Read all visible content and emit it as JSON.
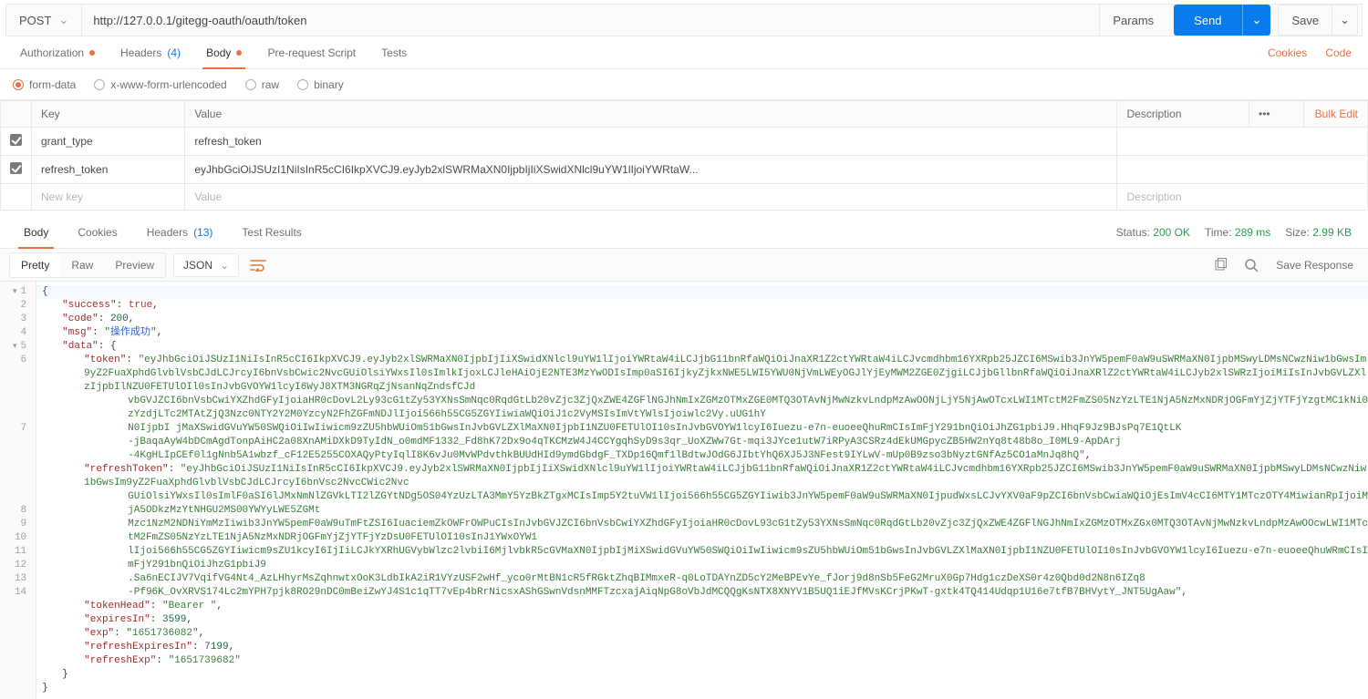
{
  "request": {
    "method": "POST",
    "url": "http://127.0.0.1/gitegg-oauth/oauth/token",
    "buttons": {
      "params": "Params",
      "send": "Send",
      "save": "Save"
    }
  },
  "reqTabs": {
    "auth": "Authorization",
    "headers": "Headers",
    "headers_count": "(4)",
    "body": "Body",
    "prerequest": "Pre-request Script",
    "tests": "Tests",
    "cookies_link": "Cookies",
    "code_link": "Code"
  },
  "bodyTypes": {
    "formdata": "form-data",
    "xwww": "x-www-form-urlencoded",
    "raw": "raw",
    "binary": "binary"
  },
  "formTable": {
    "headers": {
      "key": "Key",
      "value": "Value",
      "desc": "Description",
      "bulk": "Bulk Edit"
    },
    "rows": [
      {
        "key": "grant_type",
        "value": "refresh_token",
        "desc": ""
      },
      {
        "key": "refresh_token",
        "value": "eyJhbGciOiJSUzI1NiIsInR5cCI6IkpXVCJ9.eyJyb2xlSWRMaXN0IjpbIjIiXSwidXNlcl9uYW1lIjoiYWRtaW...",
        "desc": ""
      }
    ],
    "placeholder": {
      "key": "New key",
      "value": "Value",
      "desc": "Description"
    }
  },
  "respTabs": {
    "body": "Body",
    "cookies": "Cookies",
    "headers": "Headers",
    "headers_count": "(13)",
    "tests": "Test Results"
  },
  "respMeta": {
    "status_label": "Status:",
    "status_value": "200 OK",
    "time_label": "Time:",
    "time_value": "289 ms",
    "size_label": "Size:",
    "size_value": "2.99 KB"
  },
  "respTool": {
    "pretty": "Pretty",
    "raw": "Raw",
    "preview": "Preview",
    "lang": "JSON",
    "save_response": "Save Response"
  },
  "jsonBody": {
    "success": true,
    "code": 200,
    "msg": "操作成功",
    "data": {
      "token": "eyJhbGciOiJSUzI1NiIsInR5cCI6IkpXVCJ9.eyJyb2xlSWRMaXN0IjpbIjIiXSwidXNlcl9uYW1lIjoiYWRtaW4iLCJjbG11bnRfaWQiOiJnaXR1Z2ctYWRtaW4iLCJvcmdhbm16YXRpb25JZCI6MSwib3JnYW5pemF0aW9uSWRMaXN0IjpbMSwyLDMsNCwzNiw1bGwsIm9yZ2FuaXphdGlvblVsbCJdLCJrcyI6bnVsbCwic2NvcGUiOlsiYWxsIl0sImlkIjoxLCJleHAiOjE2NTE3MzYwODIsImp0aSI6IjkyZjkxNWE5LWI5YWU0NjVmLWEyOGJlYjEyMWM2ZGE0ZjgiLCJjbGllbnRfaWQiOiJnaXRlZ2ctYWRtaW4iLCJyb2xlSWRzIjoiMiIsInJvbGVLZXlzIjpbIlNZU0FETUlOIl0sInJvbGVOYW1lcyI6WyJ8XTM3NGRqZjNsanNqZndsfCJd",
      "token_line2": "vbGVJZCI6bnVsbCwiYXZhdGFyIjoiaHR0cDovL2Ly93cG1tZy53YXNsSmNqc0RqdGtLb20vZjc3ZjQxZWE4ZGFlNGJhNmIxZGMzOTMxZGE0MTQ3OTAvNjMwNzkvLndpMzAwOONjLjY5NjAwOTcxLWI1MTctM2FmZS05NzYzLTE1NjA5NzMxNDRjOGFmYjZjYTFjYzgtMC1kNi0zYzdjLTc2MTAtZjQ3Nzc0NTY2Y2M0YzcyN2FhZGFmNDJlIjoi566h55CG5ZGYIiwiaWQiOiJ1c2VyMSIsImVtYWlsIjoiwlc2Vy.uUG1hY",
      "token_line3": "N0IjpbI jMaXSwidGVuYW50SWQiOiIwIiwicm9zZU5hbWUiOm51bGwsInJvbGVLZXlMaXN0IjpbI1NZU0FETUlOI10sInJvbGVOYW1lcyI6Iuezu-e7n-euoeeQhuRmCIsImFjY291bnQiOiJhZG1pbiJ9.HhqF9Jz9BJsPq7E1QtLK",
      "token_line4": "-jBaqaAyW4bDCmAgdTonpAiHC2a08XnAMiDXkD9TyIdN_o0mdMF1332_Fd8hK72Dx9o4qTKCMzW4J4CCYgqhSyD9s3qr_UoXZWw7Gt-mqi3JYce1utW7iRPyA3CSRz4dEkUMGpycZB5HW2nYq8t48b8o_I0ML9-ApDArj",
      "token_line5": "-4KgHLIpCEf0l1gNnb5A1wbzf_cF12E5255COXAQyPtyIqlI8K6vJu0MvWPdvthkBUUdHId9ymdGbdgF_TXDp16Qmf1lBdtwJOdG6JIbtYhQ6XJ5J3NFest9IYLwV-mUp0B9zso3bNyztGNfAz5CO1aMnJq8hQ",
      "refreshToken": "eyJhbGciOiJSUzI1NiIsInR5cCI6IkpXVCJ9.eyJyb2xlSWRMaXN0IjpbIjIiXSwidXNlcl9uYW1lIjoiYWRtaW4iLCJjbG11bnRfaWQiOiJnaXR1Z2ctYWRtaW4iLCJvcmdhbm16YXRpb25JZCI6MSwib3JnYW5pemF0aW9uSWRMaXN0IjpbMSwyLDMsNCwzNiw1bGwsIm9yZ2FuaXphdGlvblVsbCJdLCJrcyI6bnVsc2NvcCWic2Nvc",
      "refreshToken_line2": "GUiOlsiYWxsIl0sImlF0aSI6lJMxNmNlZGVkLTI2lZGYtNDg5OS04YzUzLTA3MmY5YzBkZTgxMCIsImp5Y2tuVW1lIjoi566h55CG5ZGYIiwib3JnYW5pemF0aW9uSWRMaXN0IjpudWxsLCJvYXV0aF9pZCI6bnVsbCwiaWQiOjEsImV4cCI6MTY1MTczOTY4MiwianRpIjoiMjA5ODkzMzYtNHGU2MS00YWYyLWE5ZGMt",
      "refreshToken_line3": "Mzc1NzM2NDNiYmMzIiwib3JnYW5pemF0aW9uTmFtZSI6IuaciemZkOWFrOWPuCIsInJvbGVJZCI6bnVsbCwiYXZhdGFyIjoiaHR0cDovL93cG1tZy53YXNsSmNqc0RqdGtLb20vZjc3ZjQxZWE4ZGFlNGJhNmIxZGMzOTMxZGx0MTQ3OTAvNjMwNzkvLndpMzAwOOcwLWI1MTctM2FmZS05NzYzLTE1NjA5NzMxNDRjOGFmYjZjYTFjYzDsU0FETUlOI10sInJ1YWxOYW1",
      "refreshToken_line4": "lIjoi566h55CG5ZGYIiwicm9sZU1kcyI6IjIiLCJkYXRhUGVybWlzc2lvbiI6MjlvbkR5cGVMaXN0IjpbIjMiXSwidGVuYW50SWQiOiIwIiwicm9sZU5hbWUiOm51bGwsInJvbGVLZXlMaXN0IjpbI1NZU0FETUlOI10sInJvbGVOYW1lcyI6Iuezu-e7n-euoeeQhuWRmCIsImFjY291bnQiOiJhzG1pbiJ9",
      "refreshToken_line5": ".Sa6nECIJV7VqifVG4Nt4_AzLHhyrMsZqhnwtxOoK3LdbIkA2iR1VYzUSF2wHf_yco0rMtBN1cR5fRGktZhqBIMmxeR-q0LoTDAYnZD5cY2MeBPEvYe_fJorj9d8nSb5FeG2MruX0Gp7Hdg1czDeXS0r4z0Qbd0d2N8n6IZq8",
      "refreshToken_line6": "-Pf96K_OvXRVS174Lc2mYPH7pjk8RO29nDC0mBeiZwYJ4S1c1qTT7vEp4bRrNicsxAShGSwnVdsnMMFTzcxajAiqNpG8oVbJdMCQQgKsNTX8XNYV1B5UQ1iEJfMVsKCrjPKwT-gxtk4TQ414Udqp1U16e7tfB7BHVytY_JNT5UgAaw",
      "tokenHead": "Bearer ",
      "expiresIn": 3599,
      "exp": "1651736082",
      "refreshExpiresIn": 7199,
      "refreshExp": "1651739682"
    }
  }
}
